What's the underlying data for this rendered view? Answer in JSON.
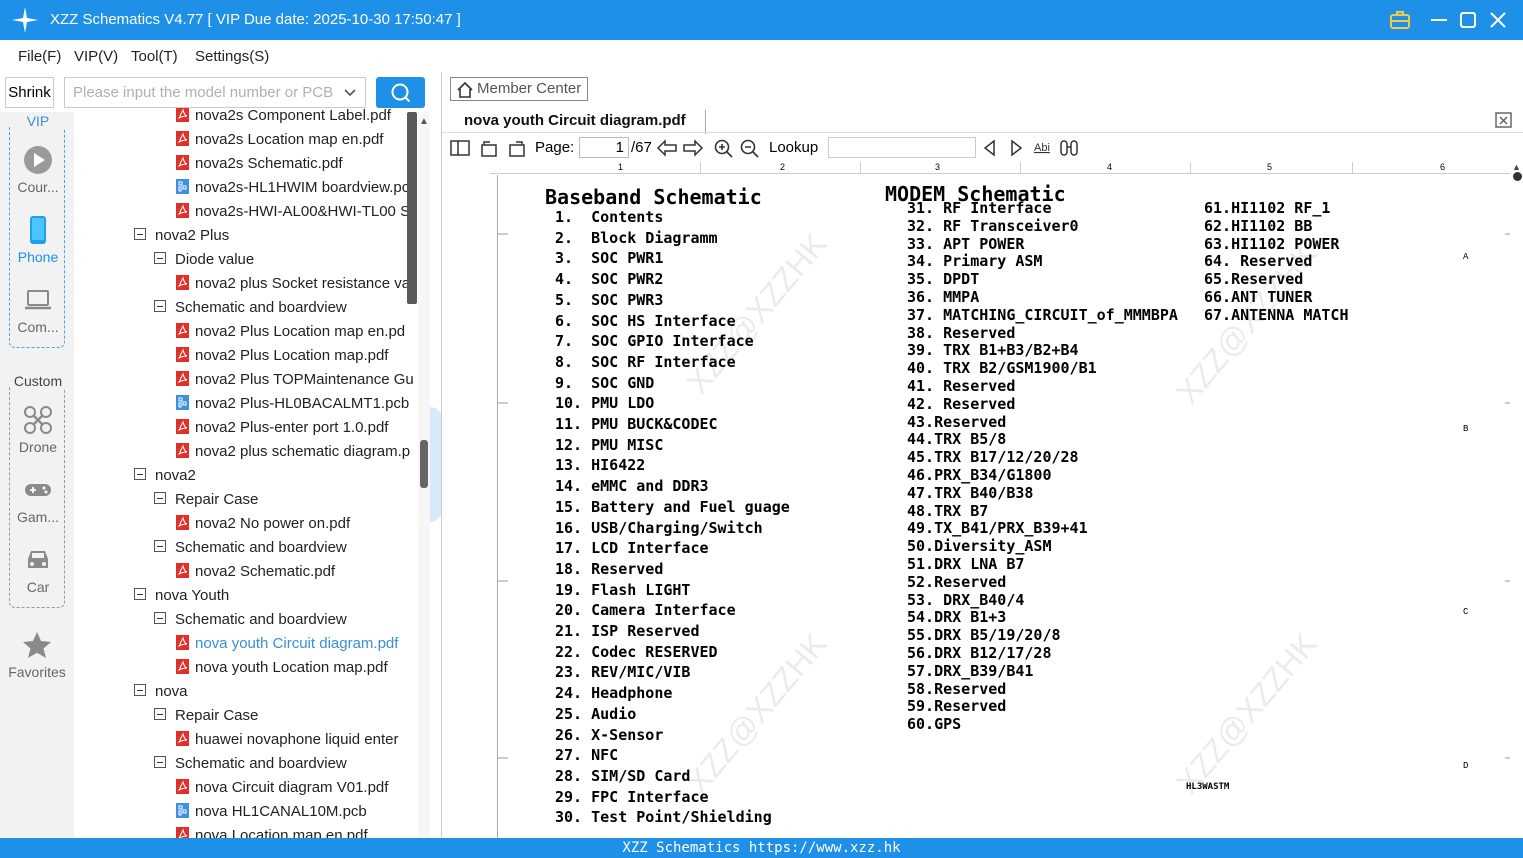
{
  "window": {
    "title": "XZZ Schematics V4.77 [ VIP Due date: 2025-10-30 17:50:47 ]"
  },
  "menu": {
    "file": "File(F)",
    "vip": "VIP(V)",
    "tool": "Tool(T)",
    "settings": "Settings(S)"
  },
  "left": {
    "shrink": "Shrink",
    "search_placeholder": "Please input the model number or PCB"
  },
  "sidebar": {
    "vip_group": "VIP",
    "items": [
      {
        "label": "Cour...",
        "icon": "play-circle-icon"
      },
      {
        "label": "Phone",
        "icon": "phone-icon"
      },
      {
        "label": "Com...",
        "icon": "laptop-icon"
      }
    ],
    "custom_group": "Custom",
    "custom_items": [
      {
        "label": "Drone",
        "icon": "drone-icon"
      },
      {
        "label": "Gam...",
        "icon": "gamepad-icon"
      },
      {
        "label": "Car",
        "icon": "car-icon"
      }
    ],
    "favorites": "Favorites"
  },
  "tree": [
    {
      "label": "nova2s Component Label.pdf",
      "type": "pdf",
      "level": 3
    },
    {
      "label": "nova2s Location map en.pdf",
      "type": "pdf",
      "level": 3
    },
    {
      "label": "nova2s Schematic.pdf",
      "type": "pdf",
      "level": 3
    },
    {
      "label": "nova2s-HL1HWIM boardview.pc",
      "type": "pcb",
      "level": 3
    },
    {
      "label": "nova2s-HWI-AL00&HWI-TL00 S",
      "type": "pdf",
      "level": 3
    },
    {
      "label": "nova2 Plus",
      "type": "folder",
      "level": 1
    },
    {
      "label": "Diode value",
      "type": "folder",
      "level": 2
    },
    {
      "label": "nova2 plus Socket resistance va",
      "type": "pdf",
      "level": 3
    },
    {
      "label": "Schematic and boardview",
      "type": "folder",
      "level": 2
    },
    {
      "label": "nova2 Plus Location map en.pd",
      "type": "pdf",
      "level": 3
    },
    {
      "label": "nova2 Plus Location map.pdf",
      "type": "pdf",
      "level": 3
    },
    {
      "label": "nova2 Plus TOPMaintenance Gu",
      "type": "pdf",
      "level": 3
    },
    {
      "label": "nova2 Plus-HL0BACALMT1.pcb",
      "type": "pcb",
      "level": 3
    },
    {
      "label": "nova2 Plus-enter port 1.0.pdf",
      "type": "pdf",
      "level": 3
    },
    {
      "label": "nova2 plus schematic diagram.p",
      "type": "pdf",
      "level": 3
    },
    {
      "label": "nova2",
      "type": "folder",
      "level": 1
    },
    {
      "label": "Repair Case",
      "type": "folder",
      "level": 2
    },
    {
      "label": "nova2 No power on.pdf",
      "type": "pdf",
      "level": 3
    },
    {
      "label": "Schematic and boardview",
      "type": "folder",
      "level": 2
    },
    {
      "label": "nova2 Schematic.pdf",
      "type": "pdf",
      "level": 3
    },
    {
      "label": "nova Youth",
      "type": "folder",
      "level": 1
    },
    {
      "label": "Schematic and boardview",
      "type": "folder",
      "level": 2
    },
    {
      "label": "nova youth Circuit diagram.pdf",
      "type": "pdf",
      "level": 3,
      "selected": true
    },
    {
      "label": "nova youth Location map.pdf",
      "type": "pdf",
      "level": 3
    },
    {
      "label": "nova",
      "type": "folder",
      "level": 1
    },
    {
      "label": "Repair Case",
      "type": "folder",
      "level": 2
    },
    {
      "label": "huawei novaphone liquid enter",
      "type": "pdf",
      "level": 3
    },
    {
      "label": "Schematic and boardview",
      "type": "folder",
      "level": 2
    },
    {
      "label": "nova Circuit diagram V01.pdf",
      "type": "pdf",
      "level": 3
    },
    {
      "label": "nova HL1CANAL10M.pcb",
      "type": "pcb",
      "level": 3
    },
    {
      "label": "nova Location map en.pdf",
      "type": "pdf",
      "level": 3
    }
  ],
  "viewer": {
    "member_center": "Member Center",
    "tab": "nova youth Circuit diagram.pdf",
    "page_label": "Page:",
    "page_value": "1",
    "page_total": "/67",
    "lookup_label": "Lookup",
    "ruler": [
      "1",
      "2",
      "3",
      "4",
      "5",
      "6"
    ],
    "row_letters": [
      "A",
      "B",
      "C",
      "D"
    ]
  },
  "schematic": {
    "left_title": "Baseband Schematic",
    "left_items": [
      "1.  Contents",
      "2.  Block Diagramm",
      "3.  SOC PWR1",
      "4.  SOC PWR2",
      "5.  SOC PWR3",
      "6.  SOC HS Interface",
      "7.  SOC GPIO Interface",
      "8.  SOC RF Interface",
      "9.  SOC GND",
      "10. PMU LDO",
      "11. PMU BUCK&CODEC",
      "12. PMU MISC",
      "13. HI6422",
      "14. eMMC and DDR3",
      "15. Battery and Fuel guage",
      "16. USB/Charging/Switch",
      "17. LCD Interface",
      "18. Reserved",
      "19. Flash LIGHT",
      "20. Camera Interface",
      "21. ISP Reserved",
      "22. Codec RESERVED",
      "23. REV/MIC/VIB",
      "24. Headphone",
      "25. Audio",
      "26. X-Sensor",
      "27. NFC",
      "28. SIM/SD Card",
      "29. FPC Interface",
      "30. Test Point/Shielding"
    ],
    "right_title": "MODEM Schematic",
    "mid_items": [
      "31. RF Interface",
      "32. RF Transceiver0",
      "33. APT POWER",
      "34. Primary ASM",
      "35. DPDT",
      "36. MMPA",
      "37. MATCHING_CIRCUIT_of_MMMBPA",
      "38. Reserved",
      "39. TRX B1+B3/B2+B4",
      "40. TRX B2/GSM1900/B1",
      "41. Reserved",
      "42. Reserved",
      "43.Reserved",
      "44.TRX B5/8",
      "45.TRX B17/12/20/28",
      "46.PRX_B34/G1800",
      "47.TRX B40/B38",
      "48.TRX B7",
      "49.TX_B41/PRX_B39+41",
      "50.Diversity_ASM",
      "51.DRX LNA B7",
      "52.Reserved",
      "53. DRX_B40/4",
      "54.DRX B1+3",
      "55.DRX B5/19/20/8",
      "56.DRX B12/17/28",
      "57.DRX_B39/B41",
      "58.Reserved",
      "59.Reserved",
      "60.GPS"
    ],
    "right_items": [
      "61.HI1102 RF_1",
      "62.HI1102 BB",
      "63.HI1102 POWER",
      "64. Reserved",
      "65.Reserved",
      "66.ANT TUNER",
      "67.ANTENNA MATCH"
    ],
    "stamp": "HL3WASTM",
    "watermark": "XZZ@XZZHK"
  },
  "status": "XZZ Schematics https://www.xzz.hk"
}
